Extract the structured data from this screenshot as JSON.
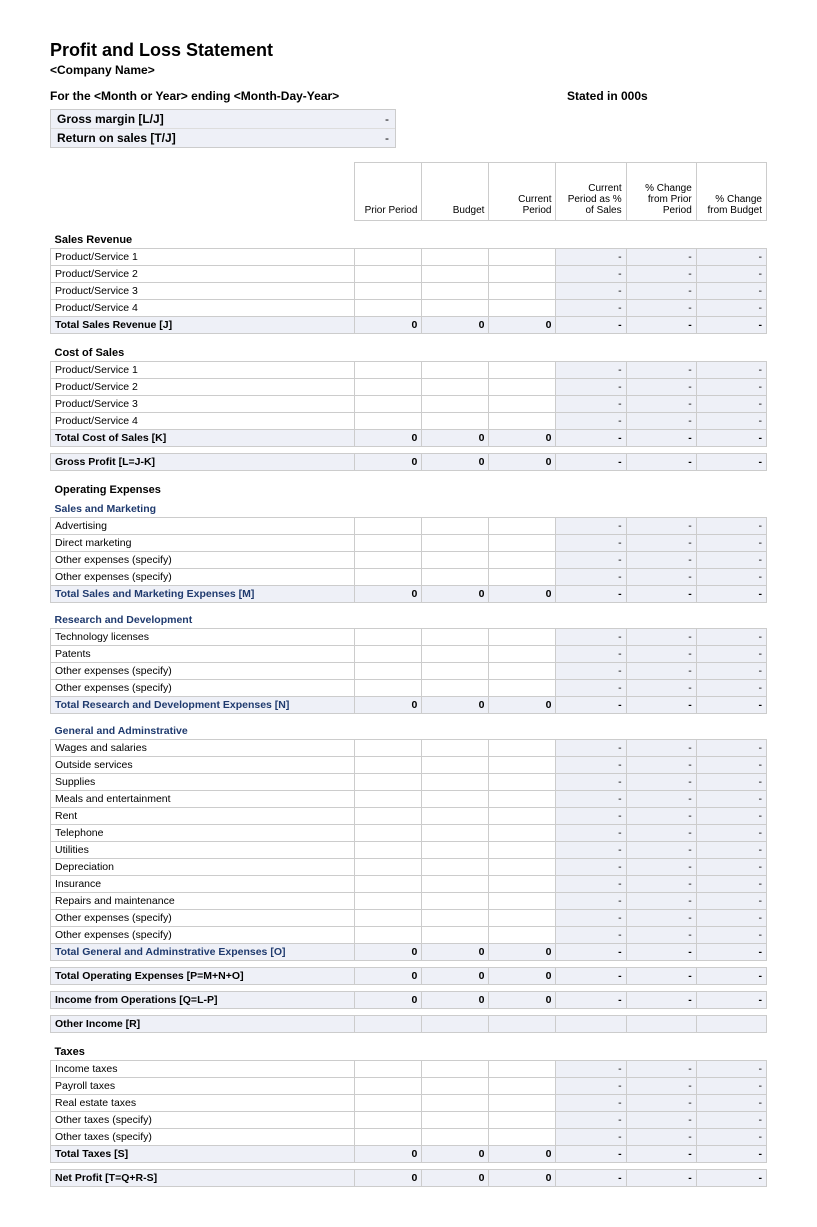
{
  "header": {
    "title": "Profit and Loss Statement",
    "company": "<Company Name>",
    "period": "For the <Month or Year> ending <Month-Day-Year>",
    "stated": "Stated in 000s"
  },
  "metrics": {
    "gross_margin_label": "Gross margin  [L/J]",
    "gross_margin_val": "-",
    "return_label": "Return on sales  [T/J]",
    "return_val": "-"
  },
  "columns": {
    "c1": "Prior Period",
    "c2": "Budget",
    "c3": "Current Period",
    "c4": "Current Period as % of Sales",
    "c5": "% Change from Prior Period",
    "c6": "% Change from Budget"
  },
  "sections": {
    "sales": {
      "title": "Sales Revenue",
      "rows": [
        {
          "label": "Product/Service 1",
          "c4": "-",
          "c5": "-",
          "c6": "-"
        },
        {
          "label": "Product/Service 2",
          "c4": "-",
          "c5": "-",
          "c6": "-"
        },
        {
          "label": "Product/Service 3",
          "c4": "-",
          "c5": "-",
          "c6": "-"
        },
        {
          "label": "Product/Service 4",
          "c4": "-",
          "c5": "-",
          "c6": "-"
        }
      ],
      "total": {
        "label": "Total Sales Revenue  [J]",
        "c1": "0",
        "c2": "0",
        "c3": "0",
        "c4": "-",
        "c5": "-",
        "c6": "-"
      }
    },
    "cos": {
      "title": "Cost of Sales",
      "rows": [
        {
          "label": "Product/Service 1",
          "c4": "-",
          "c5": "-",
          "c6": "-"
        },
        {
          "label": "Product/Service 2",
          "c4": "-",
          "c5": "-",
          "c6": "-"
        },
        {
          "label": "Product/Service 3",
          "c4": "-",
          "c5": "-",
          "c6": "-"
        },
        {
          "label": "Product/Service 4",
          "c4": "-",
          "c5": "-",
          "c6": "-"
        }
      ],
      "total": {
        "label": "Total Cost of Sales  [K]",
        "c1": "0",
        "c2": "0",
        "c3": "0",
        "c4": "-",
        "c5": "-",
        "c6": "-"
      }
    },
    "gross_profit": {
      "label": "Gross Profit  [L=J-K]",
      "c1": "0",
      "c2": "0",
      "c3": "0",
      "c4": "-",
      "c5": "-",
      "c6": "-"
    },
    "opex_title": "Operating Expenses",
    "sm": {
      "title": "Sales and Marketing",
      "rows": [
        {
          "label": "Advertising",
          "c4": "-",
          "c5": "-",
          "c6": "-"
        },
        {
          "label": "Direct marketing",
          "c4": "-",
          "c5": "-",
          "c6": "-"
        },
        {
          "label": "Other expenses (specify)",
          "c4": "-",
          "c5": "-",
          "c6": "-"
        },
        {
          "label": "Other expenses (specify)",
          "c4": "-",
          "c5": "-",
          "c6": "-"
        }
      ],
      "total": {
        "label": "Total Sales and Marketing Expenses  [M]",
        "c1": "0",
        "c2": "0",
        "c3": "0",
        "c4": "-",
        "c5": "-",
        "c6": "-"
      }
    },
    "rd": {
      "title": "Research and Development",
      "rows": [
        {
          "label": "Technology licenses",
          "c4": "-",
          "c5": "-",
          "c6": "-"
        },
        {
          "label": "Patents",
          "c4": "-",
          "c5": "-",
          "c6": "-"
        },
        {
          "label": "Other expenses (specify)",
          "c4": "-",
          "c5": "-",
          "c6": "-"
        },
        {
          "label": "Other expenses (specify)",
          "c4": "-",
          "c5": "-",
          "c6": "-"
        }
      ],
      "total": {
        "label": "Total Research and Development Expenses  [N]",
        "c1": "0",
        "c2": "0",
        "c3": "0",
        "c4": "-",
        "c5": "-",
        "c6": "-"
      }
    },
    "ga": {
      "title": "General and Adminstrative",
      "rows": [
        {
          "label": "Wages and salaries",
          "c4": "-",
          "c5": "-",
          "c6": "-"
        },
        {
          "label": "Outside services",
          "c4": "-",
          "c5": "-",
          "c6": "-"
        },
        {
          "label": "Supplies",
          "c4": "-",
          "c5": "-",
          "c6": "-"
        },
        {
          "label": "Meals and entertainment",
          "c4": "-",
          "c5": "-",
          "c6": "-"
        },
        {
          "label": "Rent",
          "c4": "-",
          "c5": "-",
          "c6": "-"
        },
        {
          "label": "Telephone",
          "c4": "-",
          "c5": "-",
          "c6": "-"
        },
        {
          "label": "Utilities",
          "c4": "-",
          "c5": "-",
          "c6": "-"
        },
        {
          "label": "Depreciation",
          "c4": "-",
          "c5": "-",
          "c6": "-"
        },
        {
          "label": "Insurance",
          "c4": "-",
          "c5": "-",
          "c6": "-"
        },
        {
          "label": "Repairs and maintenance",
          "c4": "-",
          "c5": "-",
          "c6": "-"
        },
        {
          "label": "Other expenses (specify)",
          "c4": "-",
          "c5": "-",
          "c6": "-"
        },
        {
          "label": "Other expenses (specify)",
          "c4": "-",
          "c5": "-",
          "c6": "-"
        }
      ],
      "total": {
        "label": "Total General and Adminstrative Expenses  [O]",
        "c1": "0",
        "c2": "0",
        "c3": "0",
        "c4": "-",
        "c5": "-",
        "c6": "-"
      }
    },
    "total_opex": {
      "label": "Total Operating Expenses  [P=M+N+O]",
      "c1": "0",
      "c2": "0",
      "c3": "0",
      "c4": "-",
      "c5": "-",
      "c6": "-"
    },
    "income_ops": {
      "label": "Income from Operations  [Q=L-P]",
      "c1": "0",
      "c2": "0",
      "c3": "0",
      "c4": "-",
      "c5": "-",
      "c6": "-"
    },
    "other_income": {
      "label": "Other Income  [R]"
    },
    "taxes": {
      "title": "Taxes",
      "rows": [
        {
          "label": "Income taxes",
          "c4": "-",
          "c5": "-",
          "c6": "-"
        },
        {
          "label": "Payroll taxes",
          "c4": "-",
          "c5": "-",
          "c6": "-"
        },
        {
          "label": "Real estate taxes",
          "c4": "-",
          "c5": "-",
          "c6": "-"
        },
        {
          "label": "Other taxes (specify)",
          "c4": "-",
          "c5": "-",
          "c6": "-"
        },
        {
          "label": "Other taxes (specify)",
          "c4": "-",
          "c5": "-",
          "c6": "-"
        }
      ],
      "total": {
        "label": "Total Taxes  [S]",
        "c1": "0",
        "c2": "0",
        "c3": "0",
        "c4": "-",
        "c5": "-",
        "c6": "-"
      }
    },
    "net_profit": {
      "label": "Net Profit  [T=Q+R-S]",
      "c1": "0",
      "c2": "0",
      "c3": "0",
      "c4": "-",
      "c5": "-",
      "c6": "-"
    }
  }
}
